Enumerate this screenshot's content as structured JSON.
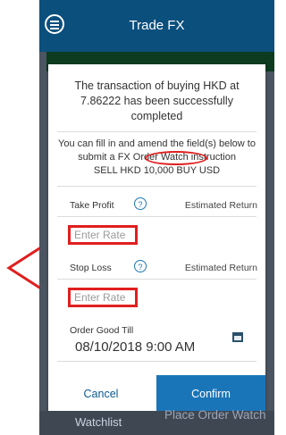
{
  "header": {
    "title": "Trade FX"
  },
  "dialog": {
    "message": "The transaction of buying HKD at 7.86222 has been successfully completed",
    "info_line1": "You can fill in and amend the field(s) below to",
    "info_line2": "submit a FX Order Watch instruction",
    "info_line3": "SELL HKD 10,000 BUY USD",
    "take_profit": {
      "label": "Take Profit",
      "help": "?",
      "estimated": "Estimated Return",
      "placeholder": "Enter Rate"
    },
    "stop_loss": {
      "label": "Stop Loss",
      "help": "?",
      "estimated": "Estimated Return",
      "placeholder": "Enter Rate"
    },
    "order_good_till": {
      "label": "Order Good Till",
      "value": "08/10/2018 9:00 AM"
    },
    "cancel_label": "Cancel",
    "confirm_label": "Confirm"
  },
  "bottom_bar": {
    "watchlist_label": "Watchlist",
    "place_order_label": "Place Order Watch"
  },
  "colors": {
    "header_bg": "#0b4f7d",
    "confirm_bg": "#1a75b8",
    "annotation_red": "#e01f1f"
  }
}
